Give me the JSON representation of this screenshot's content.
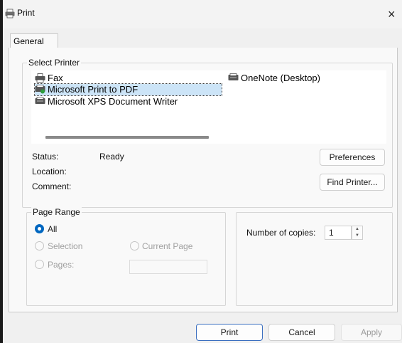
{
  "window": {
    "title": "Print",
    "close_glyph": "×"
  },
  "tabs": [
    {
      "label": "General",
      "active": true
    }
  ],
  "select_printer": {
    "label": "Select Printer",
    "printers": [
      {
        "name": "Fax",
        "icon": "fax-printer-icon"
      },
      {
        "name": "Microsoft Print to PDF",
        "icon": "pdf-printer-icon",
        "selected": true
      },
      {
        "name": "Microsoft XPS Document Writer",
        "icon": "printer-icon"
      },
      {
        "name": "OneNote (Desktop)",
        "icon": "printer-icon"
      }
    ]
  },
  "info": {
    "status_label": "Status:",
    "status_value": "Ready",
    "location_label": "Location:",
    "location_value": "",
    "comment_label": "Comment:",
    "comment_value": ""
  },
  "buttons": {
    "preferences": "Preferences",
    "find_printer": "Find Printer...",
    "print": "Print",
    "cancel": "Cancel",
    "apply": "Apply"
  },
  "page_range": {
    "label": "Page Range",
    "all": "All",
    "selection": "Selection",
    "current_page": "Current Page",
    "pages": "Pages:",
    "pages_value": "",
    "selected_option": "All"
  },
  "copies": {
    "label": "Number of copies:",
    "value": "1"
  },
  "colors": {
    "accent": "#0067c0",
    "selection": "#cce4f7",
    "default_button_border": "#3b6fc0"
  }
}
